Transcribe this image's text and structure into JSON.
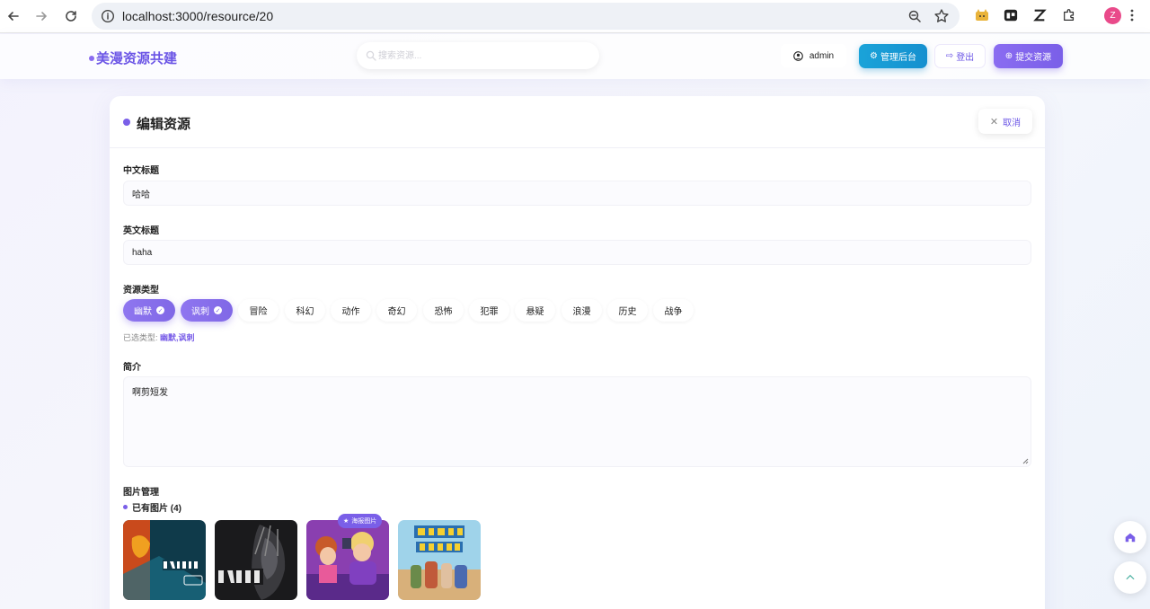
{
  "browser": {
    "url": "localhost:3000/resource/20",
    "profile_initial": "Z",
    "icons": [
      "back-arrow-icon",
      "forward-arrow-icon",
      "reload-icon",
      "info-icon",
      "zoom-icon",
      "star-icon",
      "extension-icon",
      "kebab-menu-icon"
    ]
  },
  "header": {
    "brand": "美漫资源共建",
    "search_placeholder": "搜索资源...",
    "user": "admin",
    "admin_label": "管理后台",
    "logout_label": "登出",
    "submit_label": "提交资源"
  },
  "card": {
    "title": "编辑资源",
    "cancel_label": "取消",
    "cn_title_label": "中文标题",
    "cn_title_value": "哈哈",
    "en_title_label": "英文标题",
    "en_title_value": "haha",
    "type_label": "资源类型",
    "tags": [
      {
        "label": "幽默",
        "selected": true
      },
      {
        "label": "讽刺",
        "selected": true
      },
      {
        "label": "冒险",
        "selected": false
      },
      {
        "label": "科幻",
        "selected": false
      },
      {
        "label": "动作",
        "selected": false
      },
      {
        "label": "奇幻",
        "selected": false
      },
      {
        "label": "恐怖",
        "selected": false
      },
      {
        "label": "犯罪",
        "selected": false
      },
      {
        "label": "悬疑",
        "selected": false
      },
      {
        "label": "浪漫",
        "selected": false
      },
      {
        "label": "历史",
        "selected": false
      },
      {
        "label": "战争",
        "selected": false
      }
    ],
    "selected_prefix": "已选类型:",
    "selected_value": "幽默,讽刺",
    "intro_label": "简介",
    "intro_value": "啊剪短发",
    "image_label": "图片管理",
    "existing_label": "已有图片 (4)",
    "poster_badge": "海报图片"
  },
  "colors": {
    "accent": "#7a5fe8",
    "admin": "#1590cf"
  }
}
